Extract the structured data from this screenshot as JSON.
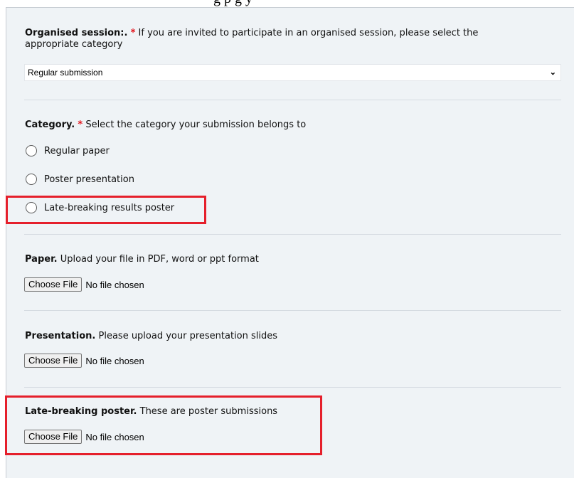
{
  "top_strip": {
    "text": "g    p        g y"
  },
  "organised_session": {
    "title": "Organised session:.",
    "required": "*",
    "description": "If you are invited to participate in an organised session, please select the",
    "description_line2": "appropriate category",
    "selected_value": "Regular submission",
    "chevron": "⌄"
  },
  "category": {
    "title": "Category.",
    "required": "*",
    "description": "Select the category your submission belongs to",
    "options": [
      {
        "label": "Regular paper"
      },
      {
        "label": "Poster presentation"
      },
      {
        "label": "Late-breaking results poster"
      }
    ]
  },
  "paper": {
    "title": "Paper.",
    "description": "Upload your file in PDF, word or ppt format",
    "button_label": "Choose File",
    "status": "No file chosen"
  },
  "presentation": {
    "title": "Presentation.",
    "description": "Please upload your presentation slides",
    "button_label": "Choose File",
    "status": "No file chosen"
  },
  "late_breaking_poster": {
    "title": "Late-breaking poster.",
    "description": "These are poster submissions",
    "button_label": "Choose File",
    "status": "No file chosen"
  },
  "colors": {
    "panel_bg": "#eff3f6",
    "required_star": "#e3131b",
    "highlight_border": "#e51f2b"
  }
}
